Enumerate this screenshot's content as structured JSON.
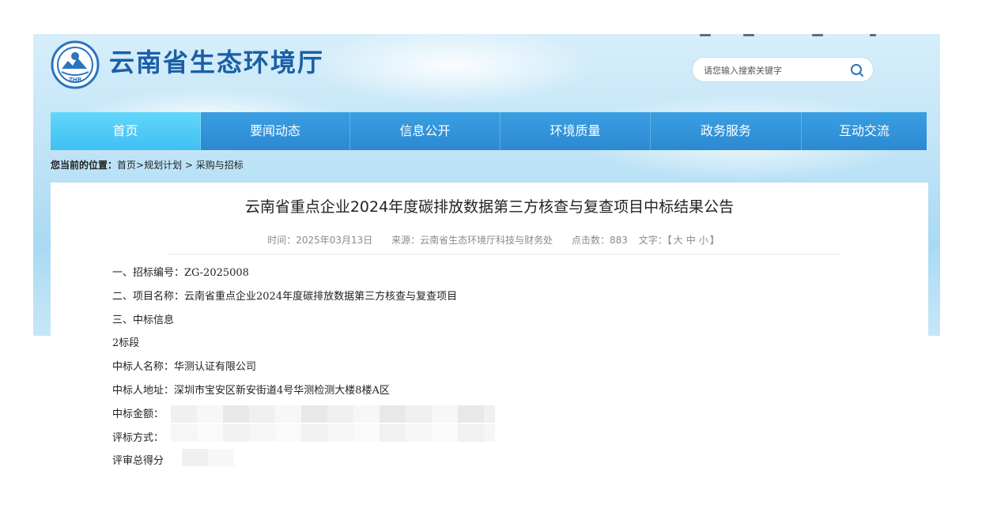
{
  "site": {
    "title": "云南省生态环境厅",
    "logo_text": "ZHB"
  },
  "search": {
    "placeholder": "请您输入搜索关键字"
  },
  "nav": {
    "items": [
      "首页",
      "要闻动态",
      "信息公开",
      "环境质量",
      "政务服务",
      "互动交流"
    ],
    "active_index": 0
  },
  "breadcrumb": {
    "label": "您当前的位置：",
    "home": "首页",
    "sep1": ">",
    "plan": "规划计划",
    "sep2": " > ",
    "current": "采购与招标"
  },
  "article": {
    "title": "云南省重点企业2024年度碳排放数据第三方核查与复查项目中标结果公告",
    "meta": {
      "time": "时间：2025年03月13日",
      "source": "来源：云南省生态环境厅科技与财务处",
      "clicks": "点击数：883",
      "font_label": "文字：",
      "bracket_open": "【",
      "size_large": "大",
      "size_medium": "中",
      "size_small": "小",
      "bracket_close": "】"
    },
    "lines": [
      "一、招标编号：ZG-2025008",
      "二、项目名称：云南省重点企业2024年度碳排放数据第三方核查与复查项目",
      "三、中标信息",
      "2标段",
      "中标人名称：华测认证有限公司",
      "中标人地址：深圳市宝安区新安街道4号华测检测大楼8楼A区",
      "中标金额：",
      "评标方式：",
      "评审总得分"
    ]
  },
  "colors": {
    "nav_bg": "#2b89d1",
    "nav_active": "#4ac6f5",
    "title_blue": "#1b5fa6"
  }
}
